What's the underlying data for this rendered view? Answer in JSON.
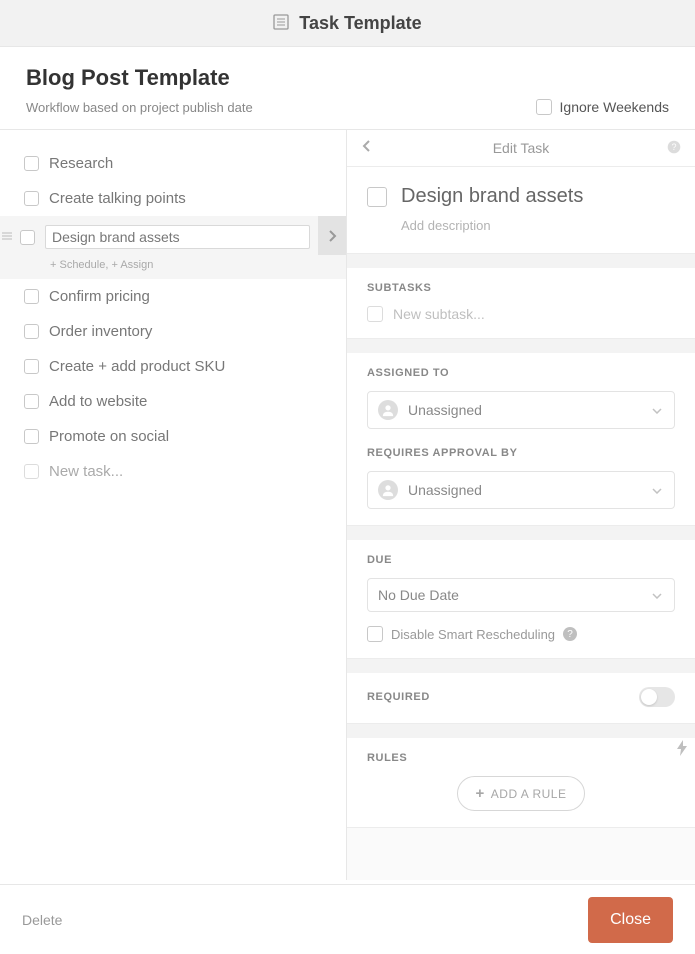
{
  "modal": {
    "title": "Task Template"
  },
  "template": {
    "name": "Blog Post Template",
    "workflow_desc": "Workflow based on project publish date",
    "ignore_weekends_label": "Ignore Weekends"
  },
  "tasks": [
    {
      "label": "Research"
    },
    {
      "label": "Create talking points"
    },
    {
      "label": "Design brand assets",
      "selected": true,
      "subtext": "+ Schedule,  + Assign"
    },
    {
      "label": "Confirm pricing"
    },
    {
      "label": "Order inventory"
    },
    {
      "label": "Create + add product SKU"
    },
    {
      "label": "Add to website"
    },
    {
      "label": "Promote on social"
    }
  ],
  "new_task_placeholder": "New task...",
  "edit_panel": {
    "header": "Edit Task",
    "task_name": "Design brand assets",
    "add_description": "Add description",
    "subtasks_title": "SUBTASKS",
    "new_subtask_placeholder": "New subtask...",
    "assigned_title": "ASSIGNED TO",
    "unassigned_label": "Unassigned",
    "approval_title": "REQUIRES APPROVAL BY",
    "due_title": "DUE",
    "no_due_label": "No Due Date",
    "disable_resched_label": "Disable Smart Rescheduling",
    "required_title": "REQUIRED",
    "rules_title": "RULES",
    "add_rule_label": "ADD A RULE"
  },
  "footer": {
    "delete_label": "Delete",
    "close_label": "Close"
  }
}
